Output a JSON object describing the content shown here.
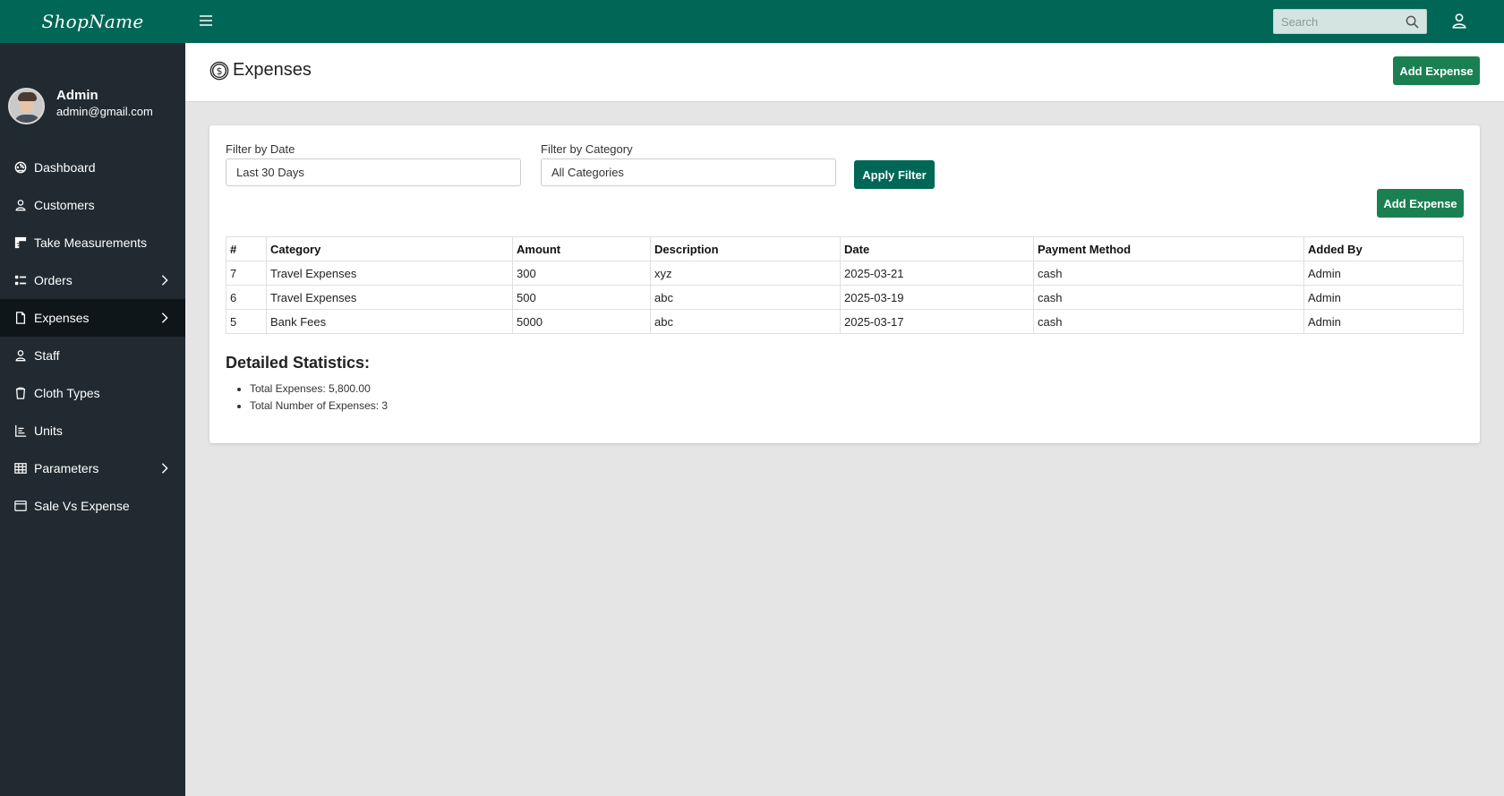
{
  "brand": "ShopName",
  "profile": {
    "name": "Admin",
    "email": "admin@gmail.com"
  },
  "sidebar": {
    "items": [
      {
        "label": "Dashboard",
        "icon": "dashboard-icon"
      },
      {
        "label": "Customers",
        "icon": "person-icon"
      },
      {
        "label": "Take Measurements",
        "icon": "ruler-icon"
      },
      {
        "label": "Orders",
        "icon": "list-icon",
        "has_submenu": true
      },
      {
        "label": "Expenses",
        "icon": "document-icon",
        "has_submenu": true,
        "active": true
      },
      {
        "label": "Staff",
        "icon": "person-icon"
      },
      {
        "label": "Cloth Types",
        "icon": "cup-icon"
      },
      {
        "label": "Units",
        "icon": "hierarchy-icon"
      },
      {
        "label": "Parameters",
        "icon": "table-icon",
        "has_submenu": true
      },
      {
        "label": "Sale Vs Expense",
        "icon": "window-icon"
      }
    ]
  },
  "topbar": {
    "search_placeholder": "Search"
  },
  "header": {
    "title": "Expenses",
    "add_label": "Add Expense"
  },
  "filters": {
    "date_label": "Filter by Date",
    "date_value": "Last 30 Days",
    "category_label": "Filter by Category",
    "category_value": "All Categories",
    "apply_label": "Apply Filter",
    "add_label": "Add Expense"
  },
  "table": {
    "columns": [
      "#",
      "Category",
      "Amount",
      "Description",
      "Date",
      "Payment Method",
      "Added By"
    ],
    "rows": [
      [
        "7",
        "Travel Expenses",
        "300",
        "xyz",
        "2025-03-21",
        "cash",
        "Admin"
      ],
      [
        "6",
        "Travel Expenses",
        "500",
        "abc",
        "2025-03-19",
        "cash",
        "Admin"
      ],
      [
        "5",
        "Bank Fees",
        "5000",
        "abc",
        "2025-03-17",
        "cash",
        "Admin"
      ]
    ]
  },
  "stats": {
    "title": "Detailed Statistics:",
    "total_expenses": "Total Expenses: 5,800.00",
    "total_count": "Total Number of Expenses: 3"
  },
  "colors": {
    "primary": "#006656",
    "success": "#1a8052",
    "sidebar": "#212a30",
    "sidebar_active": "#0f1619",
    "background": "#e5e5e5"
  }
}
